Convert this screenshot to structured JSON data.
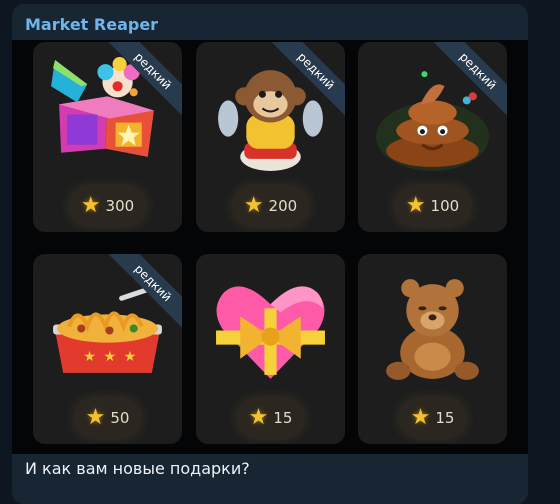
{
  "message": {
    "sender": "Market Reaper",
    "text": "И как вам новые подарки?"
  },
  "gifts": [
    {
      "name": "jack-in-the-box",
      "badge": "редкий",
      "price": "300"
    },
    {
      "name": "monkey-toy",
      "badge": "редкий",
      "price": "200"
    },
    {
      "name": "poop",
      "badge": "редкий",
      "price": "100"
    },
    {
      "name": "noodles",
      "badge": "редкий",
      "price": "50"
    },
    {
      "name": "heart-with-bow",
      "badge": "",
      "price": "15"
    },
    {
      "name": "teddy-bear",
      "badge": "",
      "price": "15"
    }
  ],
  "colors": {
    "background": "#0e1621",
    "bubble": "#182533",
    "sender": "#6fb4ea",
    "card": "#1d1d1e",
    "star": "#f2c230"
  }
}
